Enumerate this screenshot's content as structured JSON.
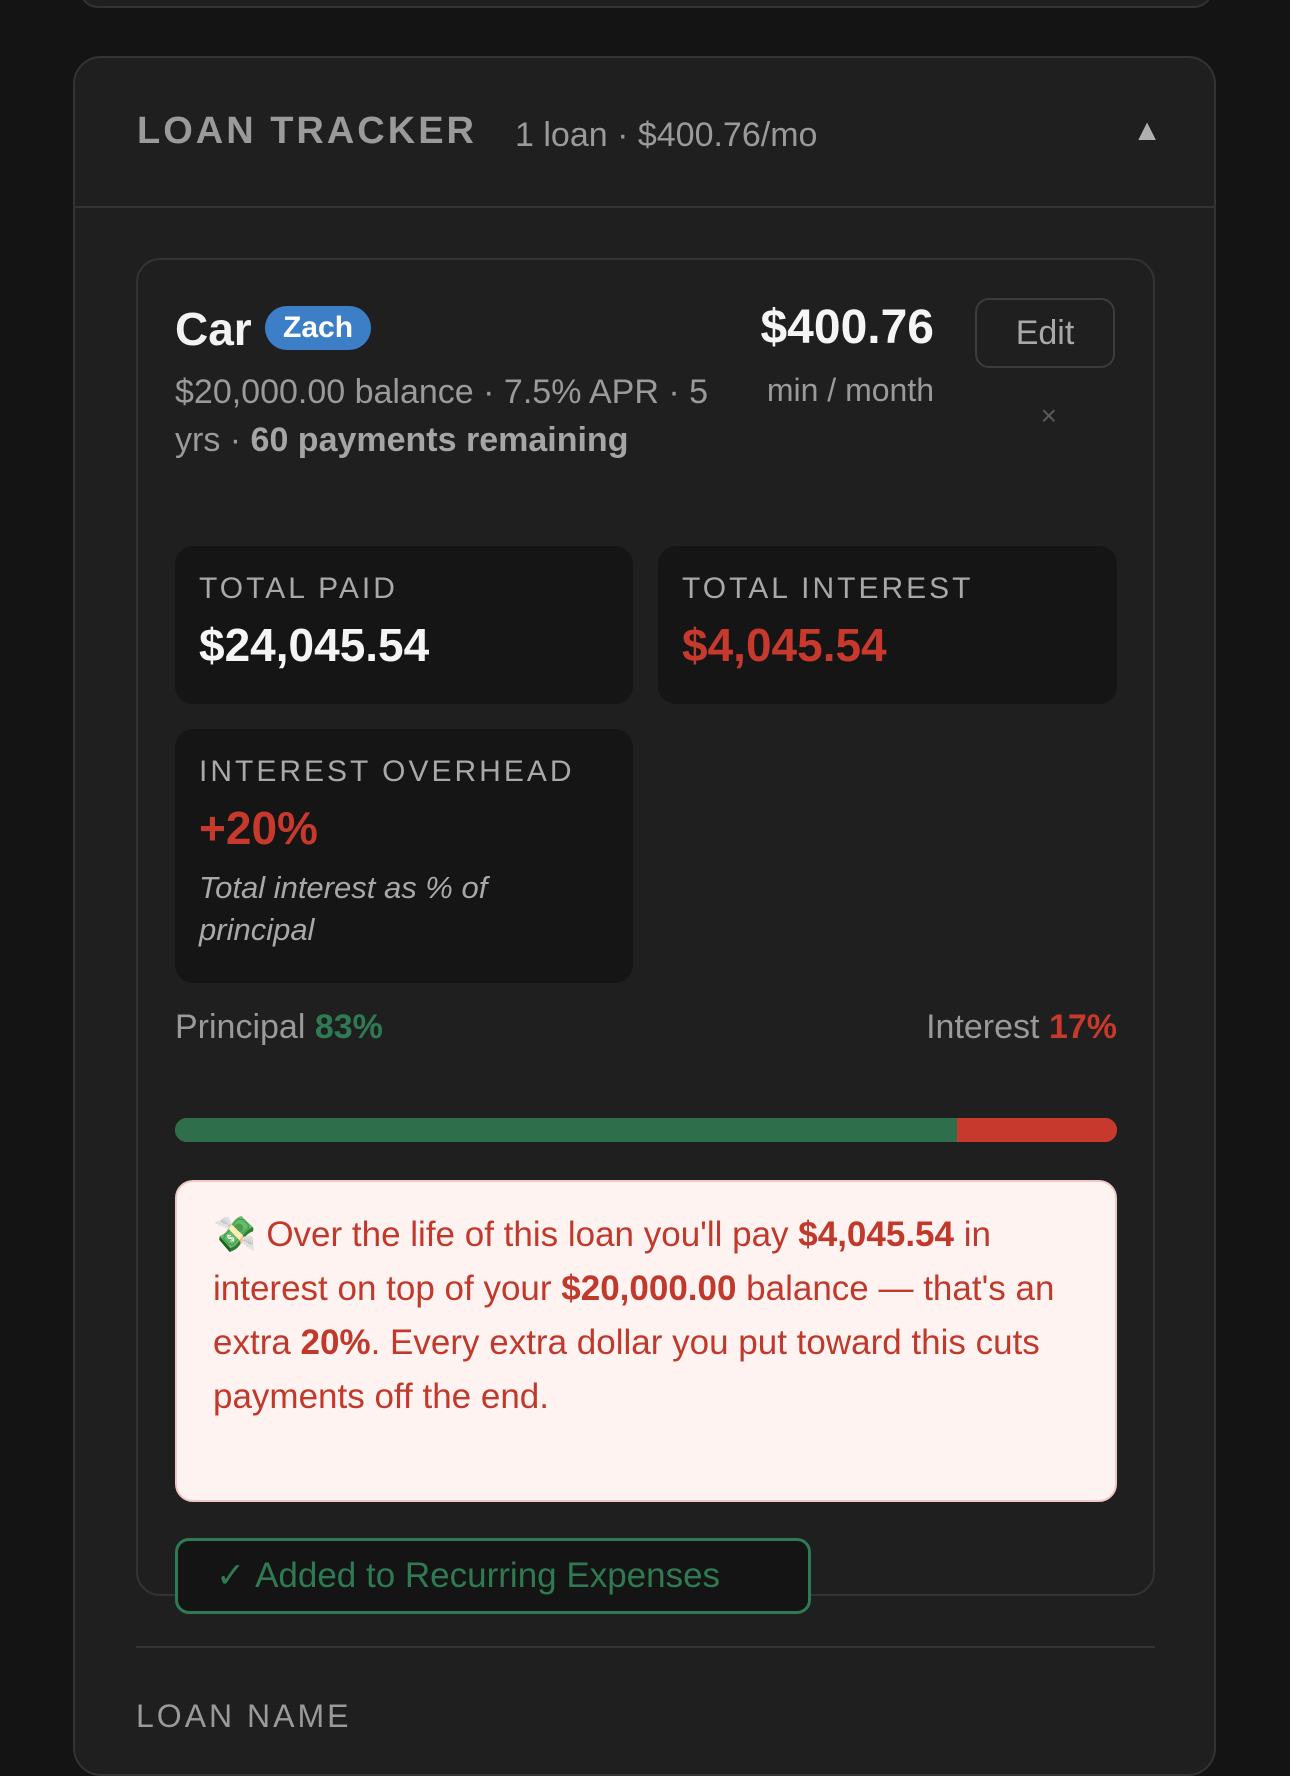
{
  "panel": {
    "title": "LOAN TRACKER",
    "summary": "1 loan · $400.76/mo",
    "collapse_icon": "▲"
  },
  "loan": {
    "name": "Car",
    "owner": "Zach",
    "monthly_payment": "$400.76",
    "monthly_payment_label": "min / month",
    "edit_label": "Edit",
    "remove_icon": "×",
    "details_prefix": "$20,000.00 balance · 7.5% APR · 5 yrs · ",
    "details_bold": "60 payments remaining"
  },
  "stats": {
    "total_paid": {
      "label": "TOTAL PAID",
      "value": "$24,045.54"
    },
    "total_interest": {
      "label": "TOTAL INTEREST",
      "value": "$4,045.54"
    },
    "interest_overhead": {
      "label": "INTEREST OVERHEAD",
      "value": "+20%",
      "note": "Total interest as % of principal"
    }
  },
  "split": {
    "principal_label": "Principal",
    "principal_pct": "83%",
    "principal_fraction": 0.83,
    "interest_label": "Interest",
    "interest_pct": "17%"
  },
  "alert": {
    "icon": "💸",
    "t1": " Over the life of this loan you'll pay ",
    "b1": "$4,045.54",
    "t2": " in interest on top of your ",
    "b2": "$20,000.00",
    "t3": " balance — that's an extra ",
    "b3": "20%",
    "t4": ". Every extra dollar you put toward this cuts payments off the end."
  },
  "recurring_button": {
    "check": "✓",
    "label": "Added to Recurring Expenses"
  },
  "form": {
    "loan_name_label": "LOAN NAME"
  },
  "colors": {
    "green": "#2f7a52",
    "red": "#c8392d",
    "badge_blue": "#3d7fc7"
  }
}
